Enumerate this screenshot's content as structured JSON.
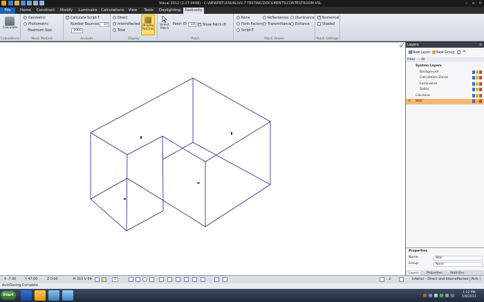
{
  "app": {
    "title": "Visual 2012 (2.07.0499) - C:\\NEWPRT\\VISUAL\\V2.7 TESTING\\DOCUMENTS\\CONTESTROOM.VSL"
  },
  "tabs": [
    "File",
    "Home",
    "Construct",
    "Modify",
    "Luminaire",
    "Calculations",
    "View",
    "Tools",
    "Daylighting",
    "Radiosity"
  ],
  "active_tab": "Radiosity",
  "ribbon": {
    "calculations": {
      "calculate_label": "Calculate",
      "group_label": "Calculations"
    },
    "mesh_method": {
      "geometric_label": "Geometric",
      "photometric_label": "Photometric",
      "max_size_label": "Maximum Size",
      "max_size_value": "2000",
      "group_label": "Mesh Method"
    },
    "analysis": {
      "calculate_script_label": "Calculate Script-T",
      "number_bounces_label": "Number Bounces",
      "number_bounces_value": "10",
      "group_label": "Analysis"
    },
    "display": {
      "direct_label": "Direct",
      "interreflected_label": "Interreflected",
      "total_label": "Total",
      "display_patches_label": "Display Patches",
      "select_patch_label": "Select Patch",
      "group_label": "Display"
    },
    "patch": {
      "patch_id_label": "Patch ID",
      "patch_id_value": "18",
      "show_patch_id_label": "Show Patch ID",
      "group_label": "Patch"
    },
    "patch_values": {
      "none_label": "None",
      "form_factors_label": "Form Factors",
      "script_label": "Script-T",
      "reflectances_label": "Reflectances",
      "transmittance_label": "Transmittance",
      "illuminance_label": "Illuminance",
      "exitance_label": "Exitance",
      "group_label": "Patch Values"
    },
    "patch_settings": {
      "numerical_label": "Numerical",
      "shaded_label": "Shaded",
      "group_label": "Patch Settings"
    }
  },
  "layers_panel": {
    "title": "Layers",
    "new_layer_label": "New Layer",
    "new_group_label": "New Group",
    "filter_label": "Filter",
    "filter_value": "- All",
    "items": [
      {
        "name": "System Layers",
        "level": 0
      },
      {
        "name": "Background",
        "level": 1
      },
      {
        "name": "Calculation Zones",
        "level": 1
      },
      {
        "name": "Luminaires",
        "level": 1
      },
      {
        "name": "Solids",
        "level": 1
      },
      {
        "name": "Calczone",
        "level": 0
      },
      {
        "name": "Wall",
        "level": 0,
        "selected": true
      }
    ]
  },
  "properties_panel": {
    "title": "Properties",
    "name_label": "Name",
    "name_value": "Wall",
    "group_label": "Group",
    "group_value": "None",
    "tabs": [
      "Layers",
      "Properties",
      "Statistics"
    ]
  },
  "status": {
    "x": "X -7.00",
    "y": "Y 47.00",
    "z": "Z 0.00",
    "hv": "H 315  V 54",
    "page": "1",
    "right_count": "2",
    "mode_text": "Interior - Direct and Interreflected | Rcfc |",
    "message": "AutoSaving Complete"
  },
  "clock": {
    "time": "1:12 PM",
    "date": "1/8/2013"
  },
  "taskbar": {
    "start_label": "Start"
  },
  "colors": {
    "accent_file": "#1e5fb3",
    "selection": "#f5b971",
    "wireframe": "#1f1f8a"
  }
}
